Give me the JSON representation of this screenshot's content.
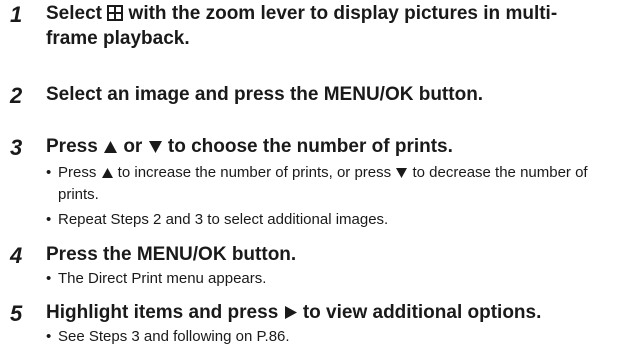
{
  "steps": [
    {
      "number": "1",
      "pre": "Select ",
      "icon": "multi-frame-icon",
      "post": " with the zoom lever to display pictures in multi-frame playback."
    },
    {
      "number": "2",
      "title": "Select an image and press the MENU/OK button."
    },
    {
      "number": "3",
      "t1": "Press ",
      "up_icon": "up-triangle-icon",
      "t2": " or ",
      "down_icon": "down-triangle-icon",
      "t3": " to choose the number of prints.",
      "bullets": [
        {
          "a": "Press ",
          "b": " to increase the number of prints, or press ",
          "c": " to decrease the number of prints."
        },
        {
          "text": "Repeat Steps 2 and 3 to select additional images."
        }
      ]
    },
    {
      "number": "4",
      "title": "Press the MENU/OK button.",
      "bullets": [
        {
          "text": "The Direct Print menu appears."
        }
      ]
    },
    {
      "number": "5",
      "pre": "Highlight items and press ",
      "icon": "right-triangle-icon",
      "post": " to view additional options.",
      "bullets": [
        {
          "text": "See Steps 3 and following on P.86."
        }
      ]
    }
  ]
}
